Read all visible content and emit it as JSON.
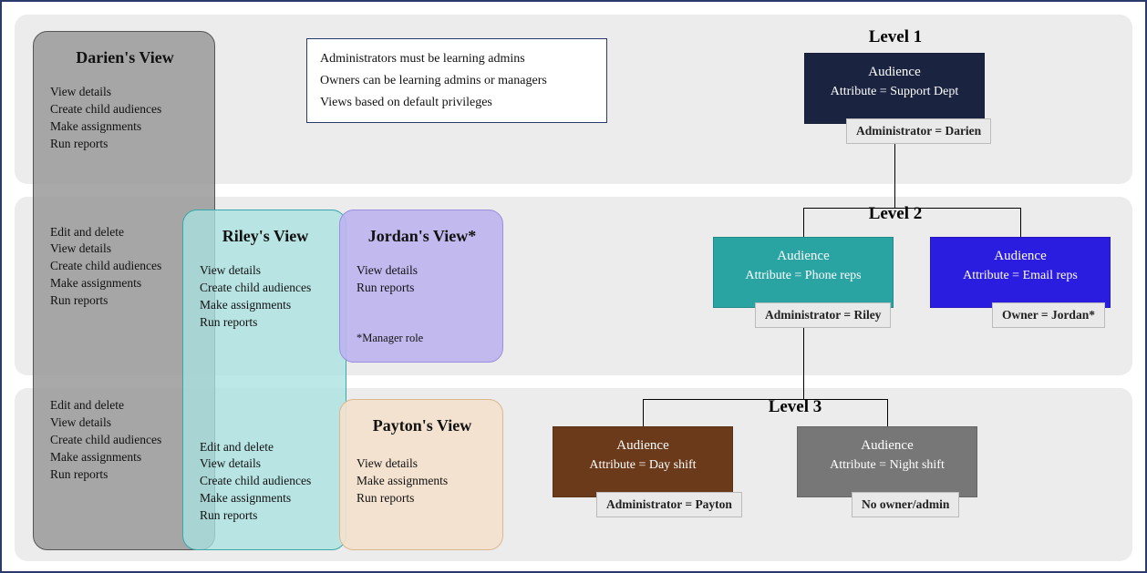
{
  "rules": {
    "line1": "Administrators must be learning admins",
    "line2": "Owners can be learning admins or managers",
    "line3": "Views based on default privileges"
  },
  "levels": {
    "l1": "Level 1",
    "l2": "Level 2",
    "l3": "Level 3"
  },
  "views": {
    "darien": {
      "title": "Darien's View",
      "l1": [
        "View details",
        "Create child audiences",
        "Make assignments",
        "Run reports"
      ],
      "l2": [
        "Edit and delete",
        "View details",
        "Create child audiences",
        "Make assignments",
        "Run reports"
      ],
      "l3": [
        "Edit and delete",
        "View details",
        "Create child audiences",
        "Make assignments",
        "Run reports"
      ]
    },
    "riley": {
      "title": "Riley's View",
      "l2": [
        "View details",
        "Create child audiences",
        "Make assignments",
        "Run reports"
      ],
      "l3": [
        "Edit and delete",
        "View details",
        "Create child audiences",
        "Make assignments",
        "Run reports"
      ]
    },
    "jordan": {
      "title": "Jordan's View*",
      "l2": [
        "View details",
        "Run reports"
      ],
      "note": "*Manager role"
    },
    "payton": {
      "title": "Payton's View",
      "l3": [
        "View details",
        "Make assignments",
        "Run reports"
      ]
    }
  },
  "nodes": {
    "support": {
      "line1": "Audience",
      "line2": "Attribute = Support Dept",
      "tag": "Administrator = Darien"
    },
    "phone": {
      "line1": "Audience",
      "line2": "Attribute = Phone reps",
      "tag": "Administrator = Riley"
    },
    "email": {
      "line1": "Audience",
      "line2": "Attribute = Email reps",
      "tag": "Owner = Jordan*"
    },
    "day": {
      "line1": "Audience",
      "line2": "Attribute = Day shift",
      "tag": "Administrator = Payton"
    },
    "night": {
      "line1": "Audience",
      "line2": "Attribute = Night shift",
      "tag": "No owner/admin"
    }
  }
}
